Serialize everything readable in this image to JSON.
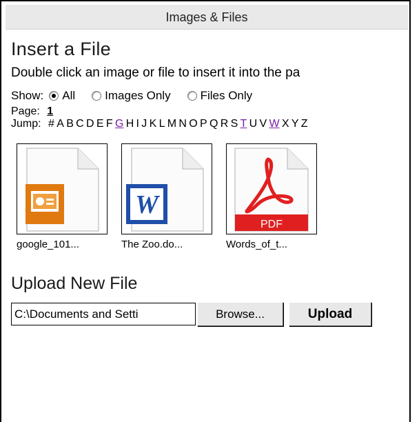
{
  "window": {
    "title": "Images & Files"
  },
  "insert": {
    "heading": "Insert a File",
    "description": "Double click an image or file to insert it into the pa",
    "show_label": "Show:",
    "show_options": [
      {
        "label": "All",
        "selected": true
      },
      {
        "label": "Images Only",
        "selected": false
      },
      {
        "label": "Files Only",
        "selected": false
      }
    ],
    "page_label": "Page:",
    "page_number": "1",
    "jump_label": "Jump:",
    "jump_letters": [
      "#",
      "A",
      "B",
      "C",
      "D",
      "E",
      "F",
      "G",
      "H",
      "I",
      "J",
      "K",
      "L",
      "M",
      "N",
      "O",
      "P",
      "Q",
      "R",
      "S",
      "T",
      "U",
      "V",
      "W",
      "X",
      "Y",
      "Z"
    ],
    "jump_links": [
      "G",
      "T",
      "W"
    ]
  },
  "files": [
    {
      "name": "google_101...",
      "icon": "powerpoint-file-icon"
    },
    {
      "name": "The Zoo.do...",
      "icon": "word-file-icon"
    },
    {
      "name": "Words_of_t...",
      "icon": "pdf-file-icon",
      "badge": "PDF"
    }
  ],
  "upload": {
    "heading": "Upload New File",
    "path_value": "C:\\Documents and Setti",
    "browse_label": "Browse...",
    "upload_label": "Upload"
  },
  "colors": {
    "link": "#7a1fa2",
    "ppt": "#e07a10",
    "word": "#1f4fa8",
    "pdf": "#e02020"
  }
}
